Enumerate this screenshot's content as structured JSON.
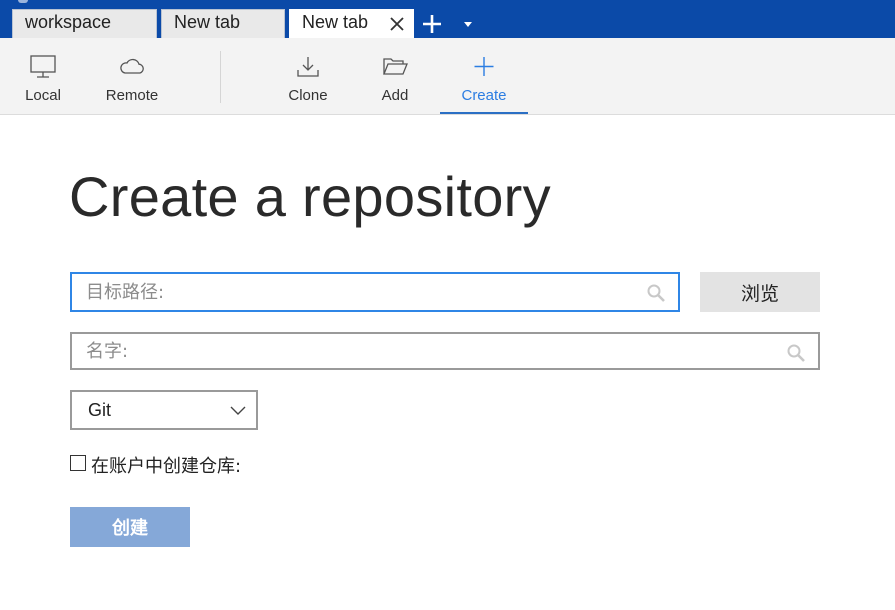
{
  "tabs": [
    {
      "label": "workspace",
      "active": false
    },
    {
      "label": "New tab",
      "active": false
    },
    {
      "label": "New tab",
      "active": true
    }
  ],
  "toolbar": {
    "local": {
      "label": "Local",
      "icon": "monitor-icon"
    },
    "remote": {
      "label": "Remote",
      "icon": "cloud-icon"
    },
    "clone": {
      "label": "Clone",
      "icon": "download-icon"
    },
    "add": {
      "label": "Add",
      "icon": "folder-open-icon"
    },
    "create": {
      "label": "Create",
      "icon": "plus-icon",
      "active": true
    }
  },
  "main": {
    "title": "Create a repository",
    "path": {
      "placeholder": "目标路径:",
      "value": ""
    },
    "browse_label": "浏览",
    "name": {
      "placeholder": "名字:",
      "value": ""
    },
    "vcs": {
      "selected": "Git"
    },
    "account_checkbox": {
      "label": "在账户中创建仓库:",
      "checked": false
    },
    "create_label": "创建"
  },
  "colors": {
    "tabbar_bg": "#0b4aa8",
    "accent": "#2b7de2",
    "create_button_bg": "#85a8d8",
    "browse_button_bg": "#e3e3e3",
    "focus_border": "#2f86e6"
  }
}
